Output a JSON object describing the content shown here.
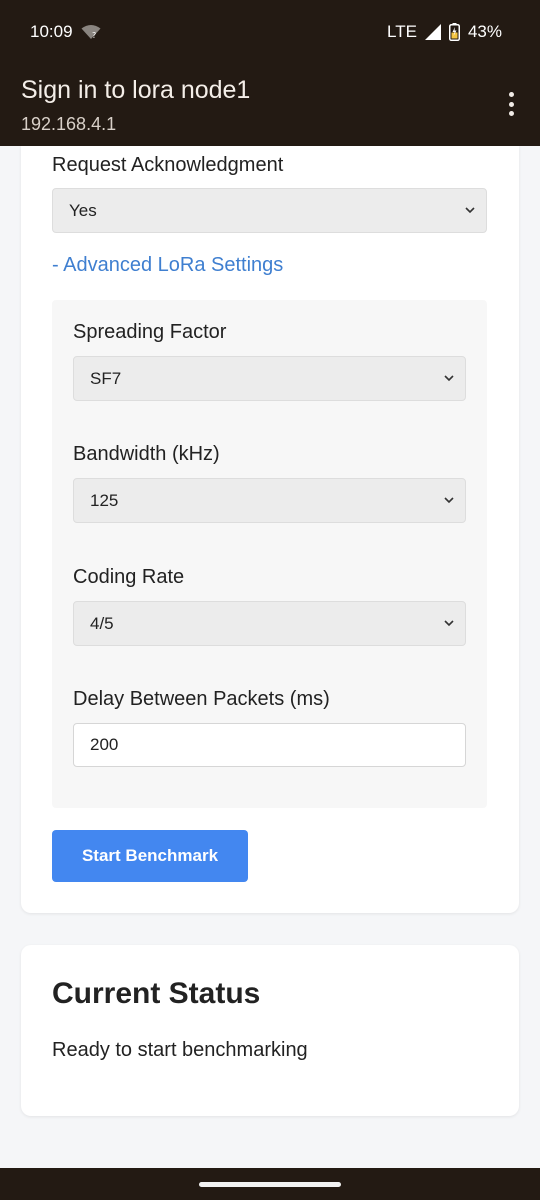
{
  "status_bar": {
    "time": "10:09",
    "network": "LTE",
    "battery": "43%"
  },
  "header": {
    "title": "Sign in to lora node1",
    "url": "192.168.4.1"
  },
  "form": {
    "ack_label": "Request Acknowledgment",
    "ack_value": "Yes",
    "advanced_link": "- Advanced LoRa Settings",
    "sf_label": "Spreading Factor",
    "sf_value": "SF7",
    "bw_label": "Bandwidth (kHz)",
    "bw_value": "125",
    "cr_label": "Coding Rate",
    "cr_value": "4/5",
    "delay_label": "Delay Between Packets (ms)",
    "delay_value": "200",
    "start_button": "Start Benchmark"
  },
  "status_card": {
    "title": "Current Status",
    "text": "Ready to start benchmarking"
  },
  "colors": {
    "accent": "#4387f0",
    "link": "#3f7fd0",
    "chrome": "#231a13"
  }
}
